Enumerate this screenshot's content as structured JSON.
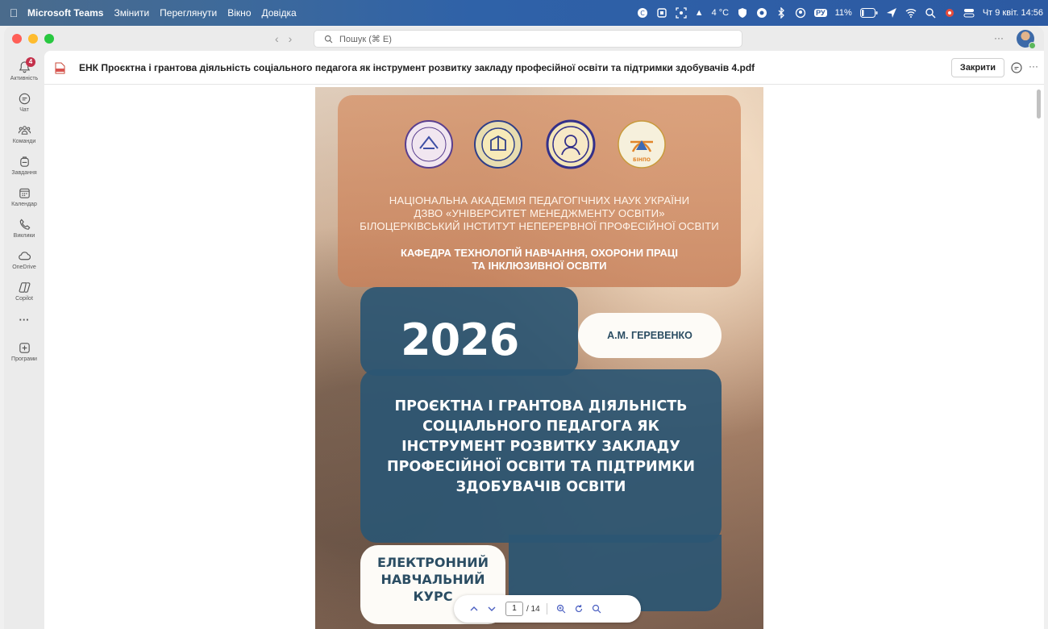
{
  "menubar": {
    "app_name": "Microsoft Teams",
    "menus": [
      "Змінити",
      "Переглянути",
      "Вікно",
      "Довідка"
    ],
    "weather": "4 °C",
    "battery": "11%",
    "keyboard_layout": "РУ",
    "datetime": "Чт 9 квіт.  14:56"
  },
  "titlebar": {
    "search_placeholder": "Пошук (⌘ E)",
    "more": "···"
  },
  "rail": {
    "items": [
      {
        "label": "Активність",
        "badge": "4"
      },
      {
        "label": "Чат"
      },
      {
        "label": "Команди"
      },
      {
        "label": "Завдання"
      },
      {
        "label": "Календар"
      },
      {
        "label": "Виклики"
      },
      {
        "label": "OneDrive"
      },
      {
        "label": "Copilot"
      },
      {
        "label": "···"
      },
      {
        "label": "Програми"
      }
    ]
  },
  "file": {
    "name": "ЕНК Проєктна і грантова діяльність соціального педагога як інструмент розвитку закладу професійної освіти та підтримки здобувачів 4.pdf",
    "close_label": "Закрити",
    "more": "···"
  },
  "cover": {
    "institutions": [
      "НАЦІОНАЛЬНА АКАДЕМІЯ ПЕДАГОГІЧНИХ НАУК УКРАЇНИ",
      "ДЗВО «УНІВЕРСИТЕТ МЕНЕДЖМЕНТУ ОСВІТИ»",
      "БІЛОЦЕРКІВСЬКИЙ ІНСТИТУТ НЕПЕРЕРВНОЇ ПРОФЕСІЙНОЇ ОСВІТИ"
    ],
    "department": [
      "КАФЕДРА ТЕХНОЛОГІЙ НАВЧАННЯ, ОХОРОНИ ПРАЦІ",
      "ТА ІНКЛЮЗИВНОЇ ОСВІТИ"
    ],
    "year": "2026",
    "author": "А.М. ГЕРЕВЕНКО",
    "title_lines": [
      "ПРОЄКТНА І ГРАНТОВА ДІЯЛЬНІСТЬ",
      "СОЦІАЛЬНОГО ПЕДАГОГА ЯК",
      "ІНСТРУМЕНТ РОЗВИТКУ ЗАКЛАДУ",
      "ПРОФЕСІЙНОЇ ОСВІТИ ТА ПІДТРИМКИ",
      "ЗДОБУВАЧІВ ОСВІТИ"
    ],
    "course_type": [
      "ЕЛЕКТРОННИЙ",
      "НАВЧАЛЬНИЙ",
      "КУРС"
    ],
    "logo_text": "БІНПО"
  },
  "pdf_toolbar": {
    "current_page": "1",
    "total_pages": "/ 14"
  },
  "colors": {
    "teams_accent": "#4a5fc1",
    "cover_blue": "#2b5673",
    "cover_orange": "#d0926a",
    "badge_red": "#c4314b"
  }
}
